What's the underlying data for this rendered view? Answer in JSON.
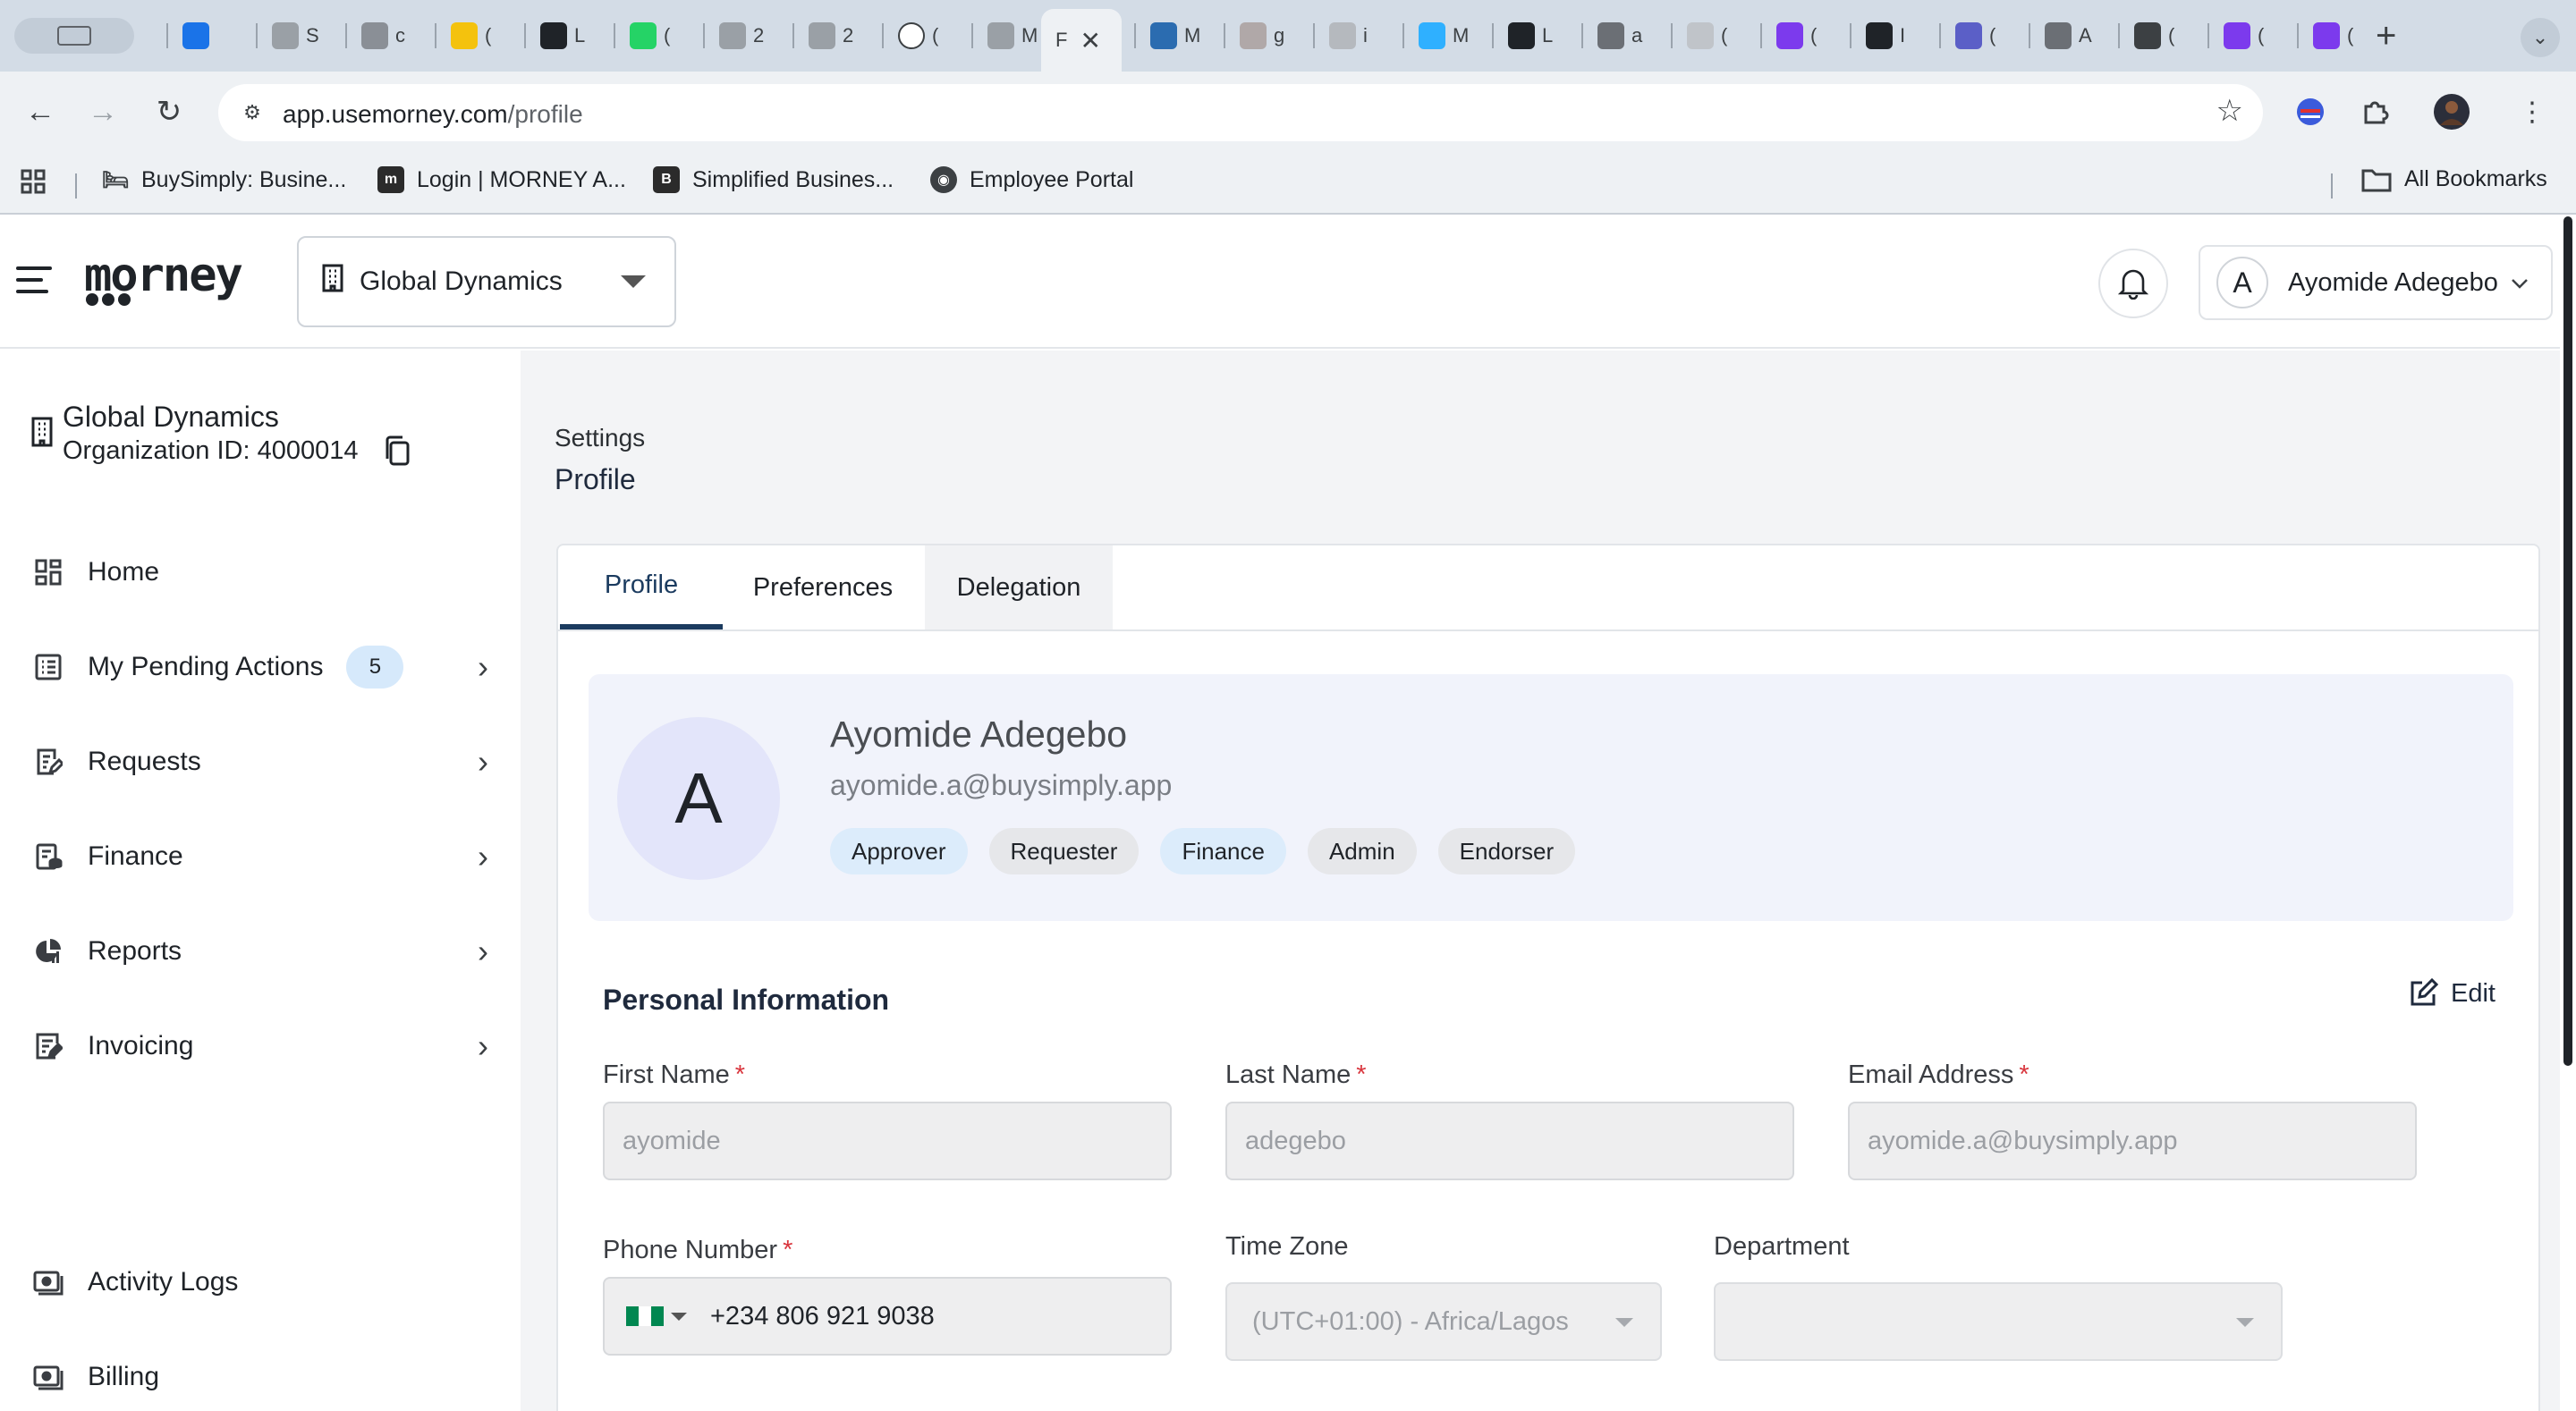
{
  "browser": {
    "tabs": [
      {
        "icon": "gem-icon",
        "title": "",
        "color": "#1a73e8"
      },
      {
        "icon": "globe-icon",
        "title": "S",
        "color": "#9aa0a6"
      },
      {
        "icon": "calendar-icon",
        "title": "c",
        "color": "#8a8f96"
      },
      {
        "icon": "notes-icon",
        "title": "(",
        "color": "#f4c20d"
      },
      {
        "icon": "morney-icon",
        "title": "L",
        "color": "#1f2328"
      },
      {
        "icon": "whatsapp-icon",
        "title": "(",
        "color": "#25d366"
      },
      {
        "icon": "globe-icon",
        "title": "2",
        "color": "#9aa0a6"
      },
      {
        "icon": "globe-icon",
        "title": "2",
        "color": "#9aa0a6"
      },
      {
        "icon": "circle-logo-icon",
        "title": "(",
        "color": "#ffffff"
      },
      {
        "icon": "globe-icon",
        "title": "M",
        "color": "#9aa0a6"
      }
    ],
    "tabs_right": [
      {
        "icon": "hex-icon",
        "title": "M",
        "color": "#2b6cb0"
      },
      {
        "icon": "bird-icon",
        "title": "g",
        "color": "#b0a8a8"
      },
      {
        "icon": "doc-icon",
        "title": "i",
        "color": "#b5b9be"
      },
      {
        "icon": "star-logo-icon",
        "title": "M",
        "color": "#2fb0ff"
      },
      {
        "icon": "b-logo-icon",
        "title": "L",
        "color": "#1f2328"
      },
      {
        "icon": "b-circle-icon",
        "title": "a",
        "color": "#6b6f75"
      },
      {
        "icon": "globe-icon",
        "title": "(",
        "color": "#c0c4c9"
      },
      {
        "icon": "g-logo-icon",
        "title": "(",
        "color": "#7c3aed"
      },
      {
        "icon": "morney-icon",
        "title": "I",
        "color": "#1f2328"
      },
      {
        "icon": "teams-icon",
        "title": "(",
        "color": "#5b5fc7"
      },
      {
        "icon": "grid-icon",
        "title": "A",
        "color": "#6b6f75"
      },
      {
        "icon": "openai-icon",
        "title": "(",
        "color": "#3c4043"
      },
      {
        "icon": "g-logo-icon",
        "title": "(",
        "color": "#7c3aed"
      },
      {
        "icon": "g-logo-icon",
        "title": "(",
        "color": "#7c3aed"
      }
    ],
    "active_tab": {
      "title": "F",
      "close": "✕"
    },
    "new_tab": "+",
    "url_host": "app.usemorney.com",
    "url_path": "/profile",
    "bookmarks": [
      {
        "label": "BuySimply: Busine...",
        "icon": "bed-icon"
      },
      {
        "label": "Login | MORNEY A...",
        "icon": "morney-icon"
      },
      {
        "label": "Simplified Busines...",
        "icon": "b-logo-icon"
      },
      {
        "label": "Employee Portal",
        "icon": "globe-icon"
      }
    ],
    "all_bookmarks": "All Bookmarks"
  },
  "header": {
    "logo": "morney",
    "org_selected": "Global Dynamics",
    "user_initial": "A",
    "user_name": "Ayomide Adegebo"
  },
  "sidebar": {
    "org_name": "Global Dynamics",
    "org_id": "Organization ID: 4000014",
    "items": [
      {
        "label": "Home",
        "icon": "dashboard-icon",
        "chevron": false
      },
      {
        "label": "My Pending Actions",
        "icon": "list-icon",
        "chevron": true,
        "badge": "5"
      },
      {
        "label": "Requests",
        "icon": "request-icon",
        "chevron": true
      },
      {
        "label": "Finance",
        "icon": "finance-icon",
        "chevron": true
      },
      {
        "label": "Reports",
        "icon": "reports-icon",
        "chevron": true
      },
      {
        "label": "Invoicing",
        "icon": "invoice-icon",
        "chevron": true
      }
    ],
    "bottom_items": [
      {
        "label": "Activity Logs",
        "icon": "activity-icon"
      },
      {
        "label": "Billing",
        "icon": "billing-icon"
      }
    ]
  },
  "main": {
    "breadcrumb": "Settings",
    "title": "Profile",
    "tabs": [
      "Profile",
      "Preferences",
      "Delegation"
    ],
    "active_tab": "Profile",
    "profile": {
      "initial": "A",
      "name": "Ayomide Adegebo",
      "email": "ayomide.a@buysimply.app",
      "roles": [
        {
          "label": "Approver",
          "style": "blue"
        },
        {
          "label": "Requester",
          "style": "gray"
        },
        {
          "label": "Finance",
          "style": "blue"
        },
        {
          "label": "Admin",
          "style": "gray"
        },
        {
          "label": "Endorser",
          "style": "gray"
        }
      ]
    },
    "section_title": "Personal Information",
    "edit_label": "Edit",
    "fields": {
      "first_name": {
        "label": "First Name",
        "value": "ayomide",
        "required": "*"
      },
      "last_name": {
        "label": "Last Name",
        "value": "adegebo",
        "required": "*"
      },
      "email": {
        "label": "Email Address",
        "value": "ayomide.a@buysimply.app",
        "required": "*"
      },
      "phone": {
        "label": "Phone Number",
        "value": "+234 806 921 9038",
        "required": "*"
      },
      "timezone": {
        "label": "Time Zone",
        "value": "(UTC+01:00) - Africa/Lagos"
      },
      "department": {
        "label": "Department",
        "value": ""
      }
    }
  },
  "colors": {
    "brand_dark": "#1b3b5f",
    "badge_blue": "#dcecfb",
    "required": "#d9363e",
    "nigeria_green": "#008751"
  }
}
